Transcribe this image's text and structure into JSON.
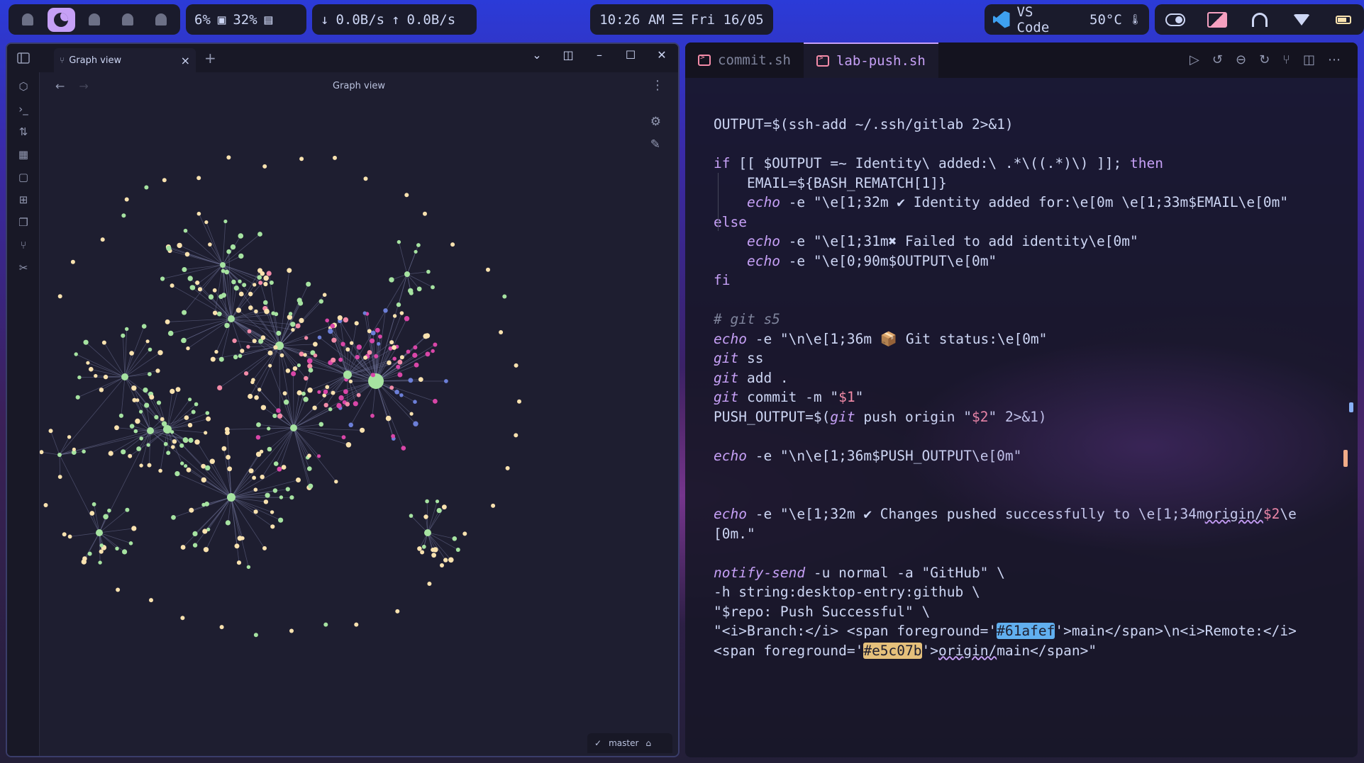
{
  "topbar": {
    "cpu": "6%",
    "mem": "32%",
    "net_down": "0.0B/s",
    "net_up": "0.0B/s",
    "time": "10:26 AM",
    "date": "Fri 16/05",
    "active_app": "VS Code",
    "temperature": "50°C"
  },
  "obsidian": {
    "tab_label": "Graph view",
    "header_title": "Graph view",
    "branch": "master"
  },
  "vscode": {
    "tabs": [
      "commit.sh",
      "lab-push.sh"
    ],
    "active_tab": "lab-push.sh",
    "code_lines": [
      "OUTPUT=$(ssh-add ~/.ssh/gitlab 2>&1)",
      "",
      "if [[ $OUTPUT =~ Identity\\ added:\\ .*\\((.*)\\) ]]; then",
      "    EMAIL=${BASH_REMATCH[1]}",
      "    echo -e \"\\e[1;32m ✔ Identity added for:\\e[0m \\e[1;33m$EMAIL\\e[0m\"",
      "else",
      "    echo -e \"\\e[1;31m✖ Failed to add identity\\e[0m\"",
      "    echo -e \"\\e[0;90m$OUTPUT\\e[0m\"",
      "fi",
      "",
      "# git s5",
      "echo -e \"\\n\\e[1;36m 📦 Git status:\\e[0m\"",
      "git ss",
      "git add .",
      "git commit -m \"$1\"",
      "PUSH_OUTPUT=$(git push origin \"$2\" 2>&1)",
      "",
      "echo -e \"\\n\\e[1;36m$PUSH_OUTPUT\\e[0m\"",
      "",
      "",
      "echo -e \"\\e[1;32m ✔ Changes pushed successfully to \\e[1;34morigin/$2\\e",
      "[0m.\"",
      "",
      "notify-send -u normal -a \"GitHub\" \\",
      "-h string:desktop-entry:github \\",
      "\"$repo: Push Successful\" \\",
      "\"<i>Branch:</i> <span foreground='#61afef'>main</span>\\n<i>Remote:</i>",
      "<span foreground='#e5c07b'>origin/main</span>\""
    ]
  },
  "colors": {
    "accent": "#c6a0f6",
    "node_green": "#a6e3a1",
    "node_yellow": "#f9e2af",
    "node_red": "#f38ba8",
    "node_pink": "#d946a8",
    "node_blue": "#6c7fd8",
    "hl_blue": "#61afef",
    "hl_gold": "#e5c07b"
  }
}
